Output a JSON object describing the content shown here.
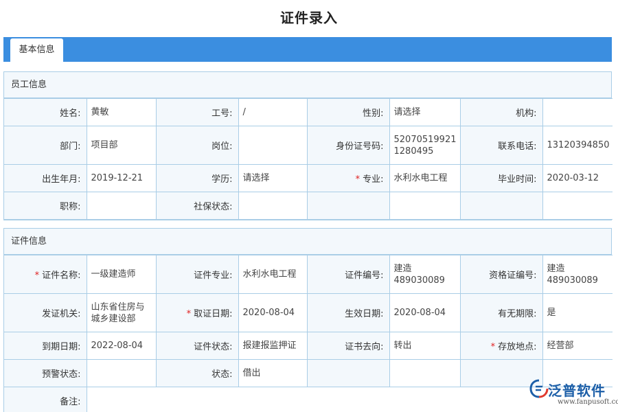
{
  "page": {
    "title": "证件录入"
  },
  "tabs": [
    {
      "label": "基本信息"
    }
  ],
  "employee": {
    "header": "员工信息",
    "rows": [
      [
        {
          "label": "姓名:",
          "value": "黄敏"
        },
        {
          "label": "工号:",
          "value": "/"
        },
        {
          "label": "性别:",
          "value": "请选择"
        },
        {
          "label": "机构:",
          "value": ""
        }
      ],
      [
        {
          "label": "部门:",
          "value": "项目部"
        },
        {
          "label": "岗位:",
          "value": ""
        },
        {
          "label": "身份证号码:",
          "value": "52070519921\n1280495"
        },
        {
          "label": "联系电话:",
          "value": "13120394850"
        }
      ],
      [
        {
          "label": "出生年月:",
          "value": "2019-12-21"
        },
        {
          "label": "学历:",
          "value": "请选择"
        },
        {
          "label": "专业:",
          "value": "水利水电工程",
          "required": true
        },
        {
          "label": "毕业时间:",
          "value": "2020-03-12"
        }
      ],
      [
        {
          "label": "职称:",
          "value": ""
        },
        {
          "label": "社保状态:",
          "value": ""
        },
        {
          "label": "",
          "value": ""
        },
        {
          "label": "",
          "value": ""
        }
      ]
    ]
  },
  "certificate": {
    "header": "证件信息",
    "rows": [
      [
        {
          "label": "证件名称:",
          "value": "一级建造师",
          "required": true
        },
        {
          "label": "证件专业:",
          "value": "水利水电工程"
        },
        {
          "label": "证件编号:",
          "value": "建造\n489030089"
        },
        {
          "label": "资格证编号:",
          "value": "建造\n489030089"
        }
      ],
      [
        {
          "label": "发证机关:",
          "value": "山东省住房与\n城乡建设部"
        },
        {
          "label": "取证日期:",
          "value": "2020-08-04",
          "required": true
        },
        {
          "label": "生效日期:",
          "value": "2020-08-04"
        },
        {
          "label": "有无期限:",
          "value": "是"
        }
      ],
      [
        {
          "label": "到期日期:",
          "value": "2022-08-04"
        },
        {
          "label": "证件状态:",
          "value": "报建报监押证"
        },
        {
          "label": "证书去向:",
          "value": "转出"
        },
        {
          "label": "存放地点:",
          "value": "经营部",
          "required": true
        }
      ],
      [
        {
          "label": "预警状态:",
          "value": ""
        },
        {
          "label": "状态:",
          "value": "借出"
        },
        {
          "label": "",
          "value": ""
        },
        {
          "label": "",
          "value": ""
        }
      ],
      [
        {
          "label": "备注:",
          "value": ""
        }
      ]
    ]
  },
  "logo": {
    "name": "泛普软件",
    "url": "www.fanpusoft.com",
    "icon": "fanpu-logo-icon"
  },
  "colors": {
    "tab_bar": "#3b8ee0",
    "border": "#a9cde6",
    "label_bg": "#f3f8fc",
    "required": "#e02020"
  }
}
